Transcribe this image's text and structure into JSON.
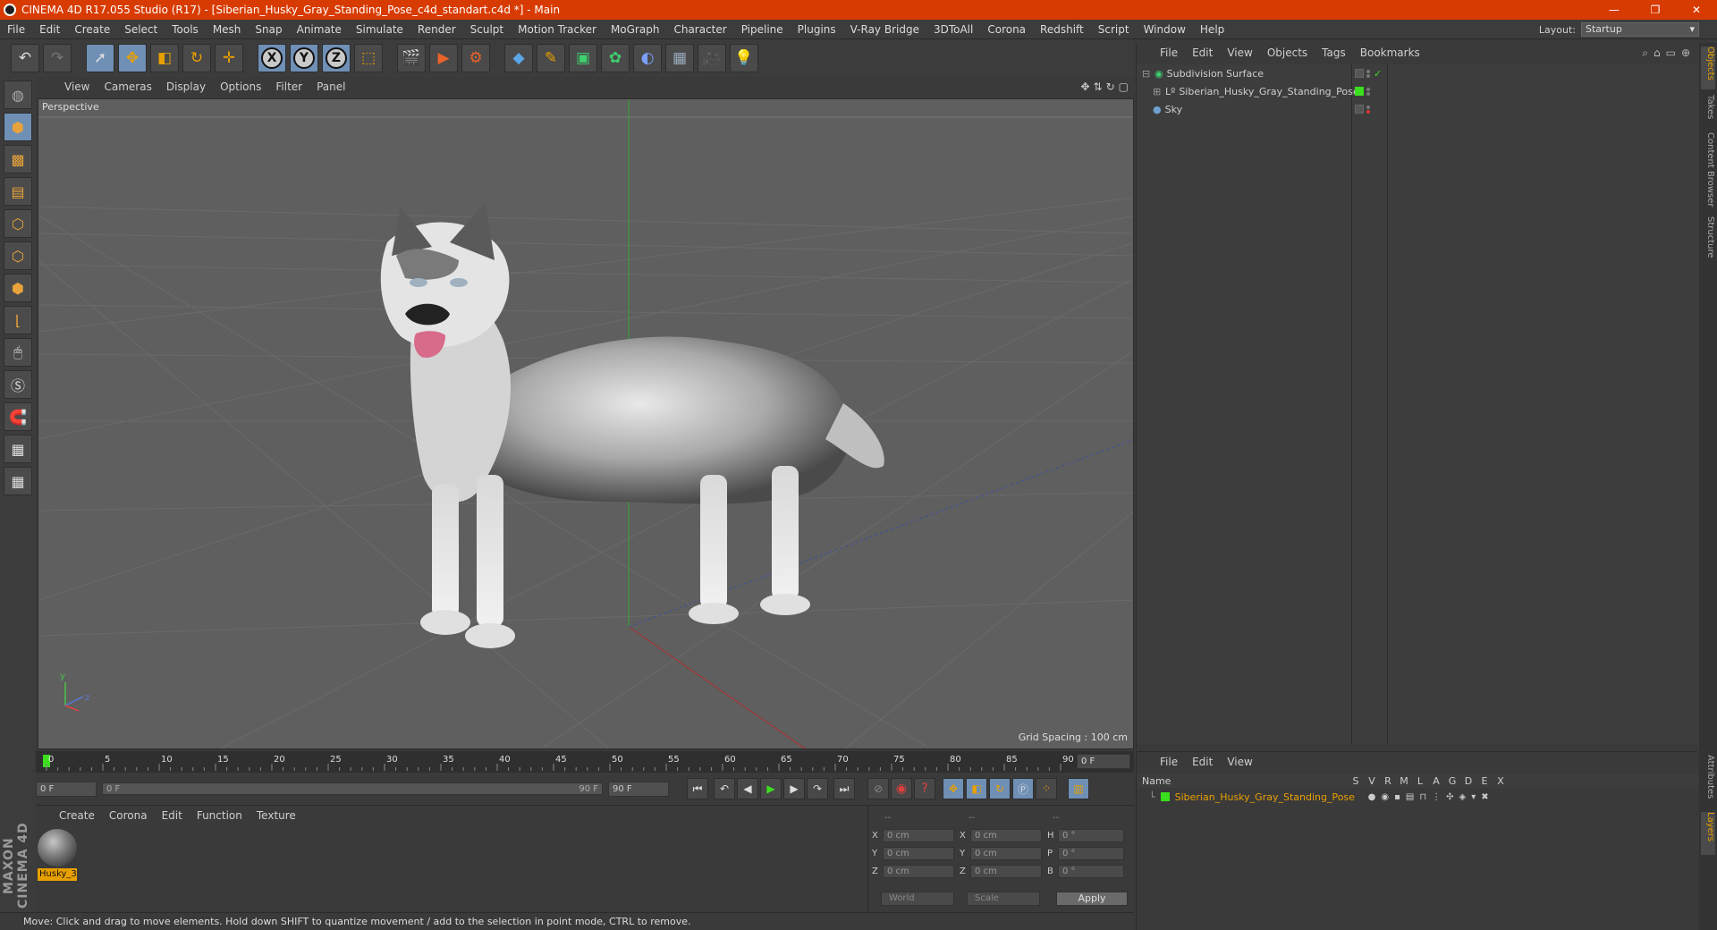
{
  "window": {
    "title": "CINEMA 4D R17.055 Studio (R17) - [Siberian_Husky_Gray_Standing_Pose_c4d_standart.c4d *] - Main",
    "controls": [
      "—",
      "❐",
      "✕"
    ]
  },
  "menubar": {
    "items": [
      "File",
      "Edit",
      "Create",
      "Select",
      "Tools",
      "Mesh",
      "Snap",
      "Animate",
      "Simulate",
      "Render",
      "Sculpt",
      "Motion Tracker",
      "MoGraph",
      "Character",
      "Pipeline",
      "Plugins",
      "V-Ray Bridge",
      "3DToAll",
      "Corona",
      "Redshift",
      "Script",
      "Window",
      "Help"
    ],
    "layout_label": "Layout:",
    "layout_value": "Startup"
  },
  "toolbar": {
    "axis_x": "X",
    "axis_y": "Y",
    "axis_z": "Z"
  },
  "viewport": {
    "menu": [
      "View",
      "Cameras",
      "Display",
      "Options",
      "Filter",
      "Panel"
    ],
    "label": "Perspective",
    "grid_spacing": "Grid Spacing : 100 cm",
    "axis_y": "y",
    "axis_z": "z"
  },
  "timeline": {
    "ticks": [
      "0",
      "5",
      "10",
      "15",
      "20",
      "25",
      "30",
      "35",
      "40",
      "45",
      "50",
      "55",
      "60",
      "65",
      "70",
      "75",
      "80",
      "85",
      "90"
    ],
    "current_frame": "0 F"
  },
  "transport": {
    "start_field": "0 F",
    "range_start": "0 F",
    "range_end": "90 F",
    "end_field": "90 F"
  },
  "material_manager": {
    "menu": [
      "Create",
      "Corona",
      "Edit",
      "Function",
      "Texture"
    ],
    "material_name": "Husky_3"
  },
  "coordinates": {
    "header": [
      "--",
      "--",
      "--"
    ],
    "rows": [
      {
        "l1": "X",
        "v1": "0 cm",
        "l2": "X",
        "v2": "0 cm",
        "l3": "H",
        "v3": "0 °"
      },
      {
        "l1": "Y",
        "v1": "0 cm",
        "l2": "Y",
        "v2": "0 cm",
        "l3": "P",
        "v3": "0 °"
      },
      {
        "l1": "Z",
        "v1": "0 cm",
        "l2": "Z",
        "v2": "0 cm",
        "l3": "B",
        "v3": "0 °"
      }
    ],
    "space": "World",
    "mode": "Scale",
    "apply": "Apply"
  },
  "status": {
    "text": "Move: Click and drag to move elements. Hold down SHIFT to quantize movement / add to the selection in point mode, CTRL to remove."
  },
  "object_manager": {
    "menu": [
      "File",
      "Edit",
      "View",
      "Objects",
      "Tags",
      "Bookmarks"
    ],
    "objects": [
      {
        "name": "Subdivision Surface"
      },
      {
        "name": "Siberian_Husky_Gray_Standing_Pose"
      },
      {
        "name": "Sky"
      }
    ]
  },
  "layer_manager": {
    "menu": [
      "File",
      "Edit",
      "View"
    ],
    "columns": [
      "Name",
      "S",
      "V",
      "R",
      "M",
      "L",
      "A",
      "G",
      "D",
      "E",
      "X"
    ],
    "layer_name": "Siberian_Husky_Gray_Standing_Pose"
  },
  "right_tabs": [
    "Objects",
    "Takes",
    "Content Browser",
    "Structure",
    "Attributes",
    "Layers"
  ],
  "colors": {
    "titlebar": "#d83b01",
    "accent_orange": "#e8a000",
    "layer_green": "#3adf1d",
    "active_blue": "#6f8fb5"
  }
}
